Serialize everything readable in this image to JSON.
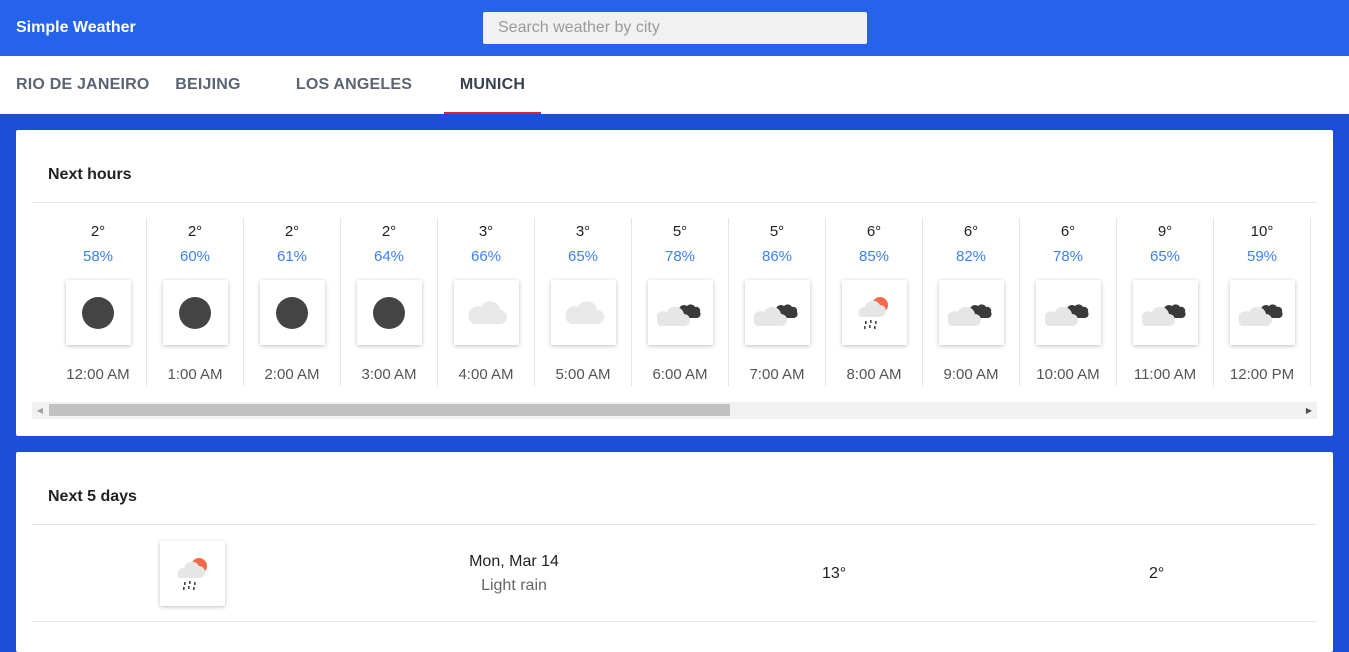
{
  "app": {
    "title": "Simple Weather"
  },
  "search": {
    "placeholder": "Search weather by city",
    "value": ""
  },
  "tabs": [
    {
      "label": "RIO DE JANEIRO",
      "active": false
    },
    {
      "label": "BEIJING",
      "active": false
    },
    {
      "label": "LOS ANGELES",
      "active": false
    },
    {
      "label": "MUNICH",
      "active": true
    }
  ],
  "colors": {
    "header": "#2563eb",
    "background": "#1d4ed8",
    "humidity": "#3b82f6",
    "active_tab_underline": "#dc2626",
    "sun": "#f26a4b"
  },
  "next_hours": {
    "title": "Next hours",
    "items": [
      {
        "temp": "2°",
        "humidity": "58%",
        "icon": "clear-night-icon",
        "time": "12:00 AM"
      },
      {
        "temp": "2°",
        "humidity": "60%",
        "icon": "clear-night-icon",
        "time": "1:00 AM"
      },
      {
        "temp": "2°",
        "humidity": "61%",
        "icon": "clear-night-icon",
        "time": "2:00 AM"
      },
      {
        "temp": "2°",
        "humidity": "64%",
        "icon": "clear-night-icon",
        "time": "3:00 AM"
      },
      {
        "temp": "3°",
        "humidity": "66%",
        "icon": "cloud-icon",
        "time": "4:00 AM"
      },
      {
        "temp": "3°",
        "humidity": "65%",
        "icon": "cloud-icon",
        "time": "5:00 AM"
      },
      {
        "temp": "5°",
        "humidity": "78%",
        "icon": "broken-clouds-icon",
        "time": "6:00 AM"
      },
      {
        "temp": "5°",
        "humidity": "86%",
        "icon": "broken-clouds-icon",
        "time": "7:00 AM"
      },
      {
        "temp": "6°",
        "humidity": "85%",
        "icon": "rain-sun-icon",
        "time": "8:00 AM"
      },
      {
        "temp": "6°",
        "humidity": "82%",
        "icon": "broken-clouds-icon",
        "time": "9:00 AM"
      },
      {
        "temp": "6°",
        "humidity": "78%",
        "icon": "broken-clouds-icon",
        "time": "10:00 AM"
      },
      {
        "temp": "9°",
        "humidity": "65%",
        "icon": "broken-clouds-icon",
        "time": "11:00 AM"
      },
      {
        "temp": "10°",
        "humidity": "59%",
        "icon": "broken-clouds-icon",
        "time": "12:00 PM"
      }
    ]
  },
  "next_days": {
    "title": "Next 5 days",
    "items": [
      {
        "date": "Mon, Mar 14",
        "description": "Light rain",
        "max": "13°",
        "min": "2°",
        "icon": "rain-sun-icon"
      }
    ]
  }
}
